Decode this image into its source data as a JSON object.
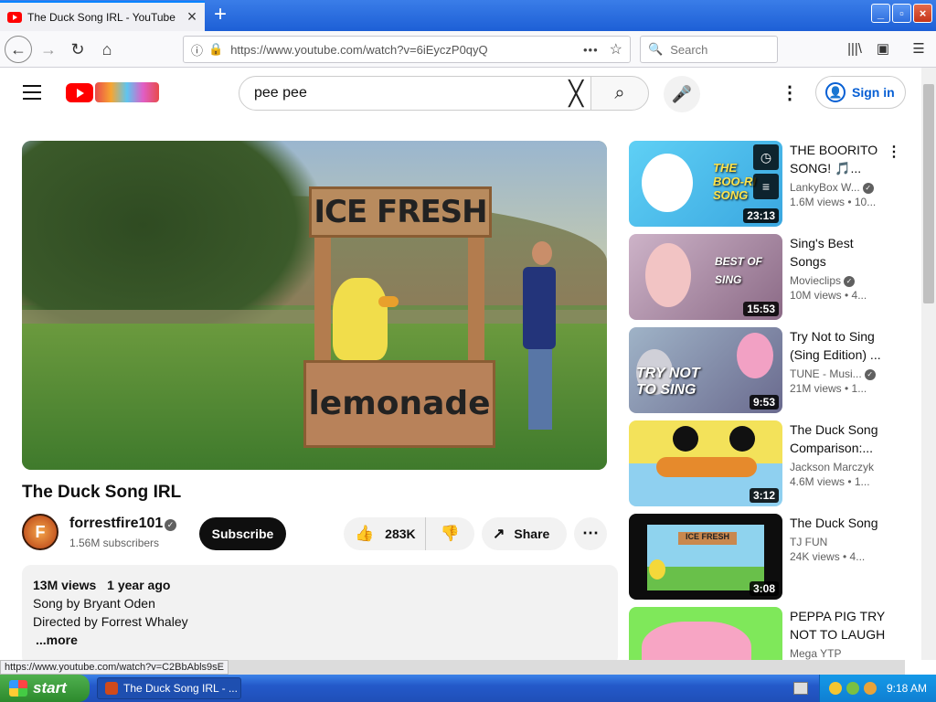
{
  "browser": {
    "tab_title": "The Duck Song IRL - YouTube",
    "url": "https://www.youtube.com/watch?v=6iEyczP0qyQ",
    "search_placeholder": "Search",
    "status_url": "https://www.youtube.com/watch?v=C2BbAbls9sE"
  },
  "header": {
    "search_query": "pee pee",
    "signin_label": "Sign in"
  },
  "video": {
    "sign_top": "ICE FRESH",
    "sign_bottom": "lemonade",
    "title": "The Duck Song IRL",
    "channel": "forrestfire101",
    "subscribers": "1.56M subscribers",
    "subscribe_label": "Subscribe",
    "likes": "283K",
    "share_label": "Share",
    "views": "13M views",
    "age": "1 year ago",
    "desc_line1": "Song by Bryant Oden",
    "desc_line2": "Directed by Forrest Whaley",
    "more_label": "...more"
  },
  "recommendations": [
    {
      "title": "THE BOORITO SONG! 🎵...",
      "channel": "LankyBox W...",
      "verified": true,
      "meta": "1.6M views • 10...",
      "duration": "23:13",
      "thumb_text": "THE BOO-RI SONG"
    },
    {
      "title": "Sing's Best Songs",
      "channel": "Movieclips",
      "verified": true,
      "meta": "10M views • 4...",
      "duration": "15:53",
      "thumb_text": "BEST OF SING"
    },
    {
      "title": "Try Not to Sing (Sing Edition) ...",
      "channel": "TUNE - Musi...",
      "verified": true,
      "meta": "21M views • 1...",
      "duration": "9:53",
      "thumb_text": "TRY NOT TO SING"
    },
    {
      "title": "The Duck Song Comparison:...",
      "channel": "Jackson Marczyk",
      "verified": false,
      "meta": "4.6M views • 1...",
      "duration": "3:12",
      "thumb_text": ""
    },
    {
      "title": "The Duck Song",
      "channel": "TJ FUN",
      "verified": false,
      "meta": "24K views • 4...",
      "duration": "3:08",
      "thumb_text": "ICE FRESH"
    },
    {
      "title": "PEPPA PIG TRY NOT TO LAUGH",
      "channel": "Mega YTP",
      "verified": false,
      "meta": "",
      "duration": "",
      "thumb_text": ""
    }
  ],
  "taskbar": {
    "start_label": "start",
    "task_title": "The Duck Song IRL - ...",
    "clock": "9:18 AM"
  }
}
